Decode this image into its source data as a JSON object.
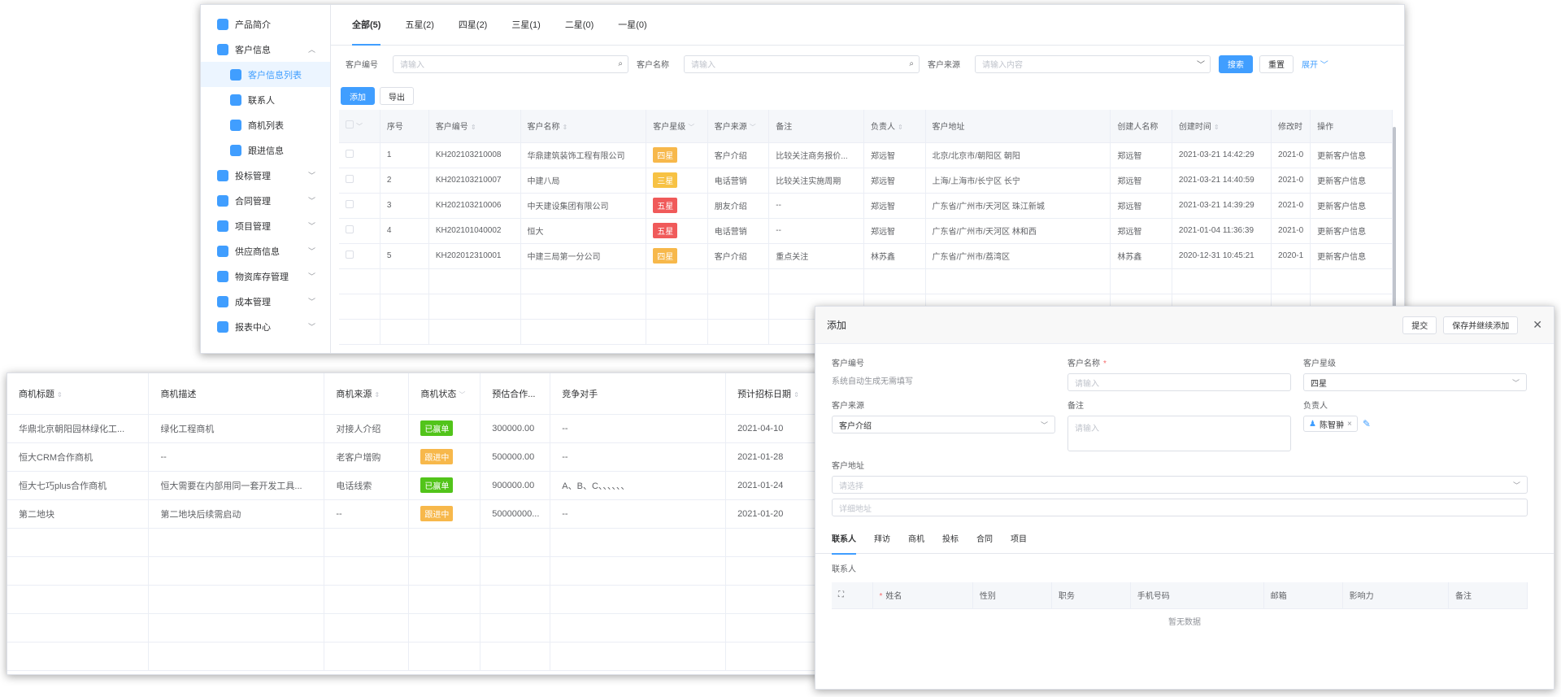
{
  "sidebar": {
    "items": [
      {
        "label": "产品简介",
        "icon": "home-icon",
        "sub": false,
        "active": false,
        "chev": ""
      },
      {
        "label": "客户信息",
        "icon": "customer-icon",
        "sub": false,
        "active": false,
        "chev": "︿"
      },
      {
        "label": "客户信息列表",
        "icon": "user-icon",
        "sub": true,
        "active": true,
        "chev": ""
      },
      {
        "label": "联系人",
        "icon": "contacts-icon",
        "sub": true,
        "active": false,
        "chev": ""
      },
      {
        "label": "商机列表",
        "icon": "opportunity-icon",
        "sub": true,
        "active": false,
        "chev": ""
      },
      {
        "label": "跟进信息",
        "icon": "mail-icon",
        "sub": true,
        "active": false,
        "chev": ""
      },
      {
        "label": "投标管理",
        "icon": "send-icon",
        "sub": false,
        "active": false,
        "chev": "﹀"
      },
      {
        "label": "合同管理",
        "icon": "contract-icon",
        "sub": false,
        "active": false,
        "chev": "﹀"
      },
      {
        "label": "项目管理",
        "icon": "project-icon",
        "sub": false,
        "active": false,
        "chev": "﹀"
      },
      {
        "label": "供应商信息",
        "icon": "truck-icon",
        "sub": false,
        "active": false,
        "chev": "﹀"
      },
      {
        "label": "物资库存管理",
        "icon": "cloud-icon",
        "sub": false,
        "active": false,
        "chev": "﹀"
      },
      {
        "label": "成本管理",
        "icon": "cost-icon",
        "sub": false,
        "active": false,
        "chev": "﹀"
      },
      {
        "label": "报表中心",
        "icon": "report-icon",
        "sub": false,
        "active": false,
        "chev": "﹀"
      }
    ]
  },
  "tabs": [
    {
      "label": "全部(5)",
      "active": true
    },
    {
      "label": "五星(2)",
      "active": false
    },
    {
      "label": "四星(2)",
      "active": false
    },
    {
      "label": "三星(1)",
      "active": false
    },
    {
      "label": "二星(0)",
      "active": false
    },
    {
      "label": "一星(0)",
      "active": false
    }
  ],
  "filters": {
    "code_label": "客户编号",
    "code_placeholder": "请输入",
    "name_label": "客户名称",
    "name_placeholder": "请输入",
    "source_label": "客户来源",
    "source_placeholder": "请输入内容",
    "search": "搜索",
    "reset": "重置",
    "expand": "展开"
  },
  "actions": {
    "add": "添加",
    "export": "导出"
  },
  "customers": {
    "headers": [
      "序号",
      "客户编号",
      "客户名称",
      "客户星级",
      "客户来源",
      "备注",
      "负责人",
      "客户地址",
      "创建人名称",
      "创建时间",
      "修改时",
      "操作"
    ],
    "rows": [
      {
        "no": "1",
        "code": "KH202103210008",
        "name": "华鼎建筑装饰工程有限公司",
        "star": "四星",
        "star_color": "#f7b84b",
        "source": "客户介绍",
        "note": "比较关注商务报价...",
        "owner": "郑远智",
        "address": "北京/北京市/朝阳区 朝阳",
        "creator": "郑远智",
        "created": "2021-03-21 14:42:29",
        "modified": "2021-0",
        "op": "更新客户信息"
      },
      {
        "no": "2",
        "code": "KH202103210007",
        "name": "中建八局",
        "star": "三星",
        "star_color": "#f7c244",
        "source": "电话营销",
        "note": "比较关注实施周期",
        "owner": "郑远智",
        "address": "上海/上海市/长宁区 长宁",
        "creator": "郑远智",
        "created": "2021-03-21 14:40:59",
        "modified": "2021-0",
        "op": "更新客户信息"
      },
      {
        "no": "3",
        "code": "KH202103210006",
        "name": "中天建设集团有限公司",
        "star": "五星",
        "star_color": "#f05a5a",
        "source": "朋友介绍",
        "note": "--",
        "owner": "郑远智",
        "address": "广东省/广州市/天河区 珠江新城",
        "creator": "郑远智",
        "created": "2021-03-21 14:39:29",
        "modified": "2021-0",
        "op": "更新客户信息"
      },
      {
        "no": "4",
        "code": "KH202101040002",
        "name": "恒大",
        "star": "五星",
        "star_color": "#f05a5a",
        "source": "电话营销",
        "note": "--",
        "owner": "郑远智",
        "address": "广东省/广州市/天河区 林和西",
        "creator": "郑远智",
        "created": "2021-01-04 11:36:39",
        "modified": "2021-0",
        "op": "更新客户信息"
      },
      {
        "no": "5",
        "code": "KH202012310001",
        "name": "中建三局第一分公司",
        "star": "四星",
        "star_color": "#f7b84b",
        "source": "客户介绍",
        "note": "重点关注",
        "owner": "林苏鑫",
        "address": "广东省/广州市/荔湾区",
        "creator": "林苏鑫",
        "created": "2020-12-31 10:45:21",
        "modified": "2020-1",
        "op": "更新客户信息"
      }
    ]
  },
  "opportunities": {
    "headers": [
      "商机标题",
      "商机描述",
      "商机来源",
      "商机状态",
      "预估合作...",
      "竞争对手",
      "预计招标日期"
    ],
    "rows": [
      {
        "title": "华鼎北京朝阳园林绿化工...",
        "desc": "绿化工程商机",
        "source": "对接人介绍",
        "status": "已赢单",
        "status_color": "#52c41a",
        "amount": "300000.00",
        "rival": "--",
        "date": "2021-04-10"
      },
      {
        "title": "恒大CRM合作商机",
        "desc": "--",
        "source": "老客户增购",
        "status": "跟进中",
        "status_color": "#f7b84b",
        "amount": "500000.00",
        "rival": "--",
        "date": "2021-01-28"
      },
      {
        "title": "恒大七巧plus合作商机",
        "desc": "恒大需要在内部用同一套开发工具...",
        "source": "电话线索",
        "status": "已赢单",
        "status_color": "#52c41a",
        "amount": "900000.00",
        "rival": "A、B、C、、、、、、",
        "date": "2021-01-24"
      },
      {
        "title": "第二地块",
        "desc": "第二地块后续需启动",
        "source": "--",
        "status": "跟进中",
        "status_color": "#f7b84b",
        "amount": "50000000...",
        "rival": "--",
        "date": "2021-01-20"
      }
    ]
  },
  "dialog": {
    "title": "添加",
    "submit": "提交",
    "save_continue": "保存并继续添加",
    "close": "✕",
    "code_label": "客户编号",
    "code_hint": "系统自动生成无需填写",
    "name_label": "客户名称",
    "name_placeholder": "请输入",
    "star_label": "客户星级",
    "star_value": "四星",
    "source_label": "客户来源",
    "source_value": "客户介绍",
    "note_label": "备注",
    "note_placeholder": "请输入",
    "owner_label": "负责人",
    "owner_value": "陈智翀",
    "address_label": "客户地址",
    "address_placeholder": "请选择",
    "detail_placeholder": "详细地址",
    "tabs": [
      "联系人",
      "拜访",
      "商机",
      "投标",
      "合同",
      "项目"
    ],
    "contacts_label": "联系人",
    "contacts_headers": [
      "姓名",
      "性别",
      "职务",
      "手机号码",
      "邮箱",
      "影响力",
      "备注"
    ],
    "empty": "暂无数据"
  }
}
